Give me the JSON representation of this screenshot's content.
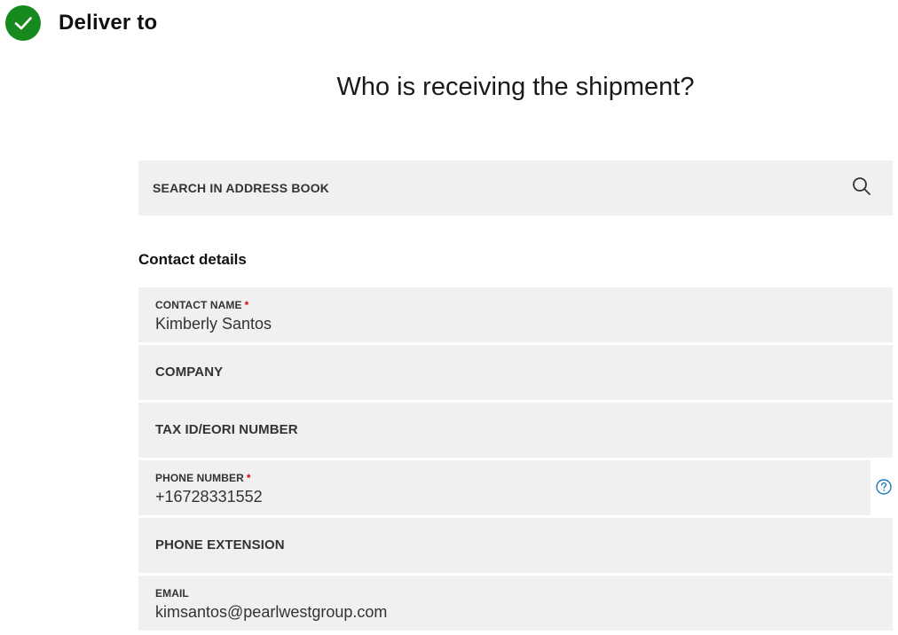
{
  "step": {
    "title": "Deliver to"
  },
  "question": "Who is receiving the shipment?",
  "search": {
    "label": "SEARCH IN ADDRESS BOOK"
  },
  "contact_section": {
    "title": "Contact details",
    "fields": {
      "contact_name": {
        "label": "CONTACT NAME",
        "required_mark": "*",
        "value": "Kimberly Santos"
      },
      "company": {
        "label": "COMPANY"
      },
      "tax_id": {
        "label": "TAX ID/EORI NUMBER"
      },
      "phone": {
        "label": "PHONE NUMBER",
        "required_mark": "*",
        "value": "+16728331552"
      },
      "phone_extension": {
        "label": "PHONE EXTENSION"
      },
      "email": {
        "label": "EMAIL",
        "value": "kimsantos@pearlwestgroup.com"
      }
    }
  },
  "colors": {
    "check_green": "#168a1f",
    "required_red": "#d40511",
    "help_blue": "#1f7ab8",
    "field_bg": "#f0f0f0"
  },
  "icons": {
    "step_status": "check-icon",
    "search": "search-icon",
    "help": "help-icon"
  }
}
